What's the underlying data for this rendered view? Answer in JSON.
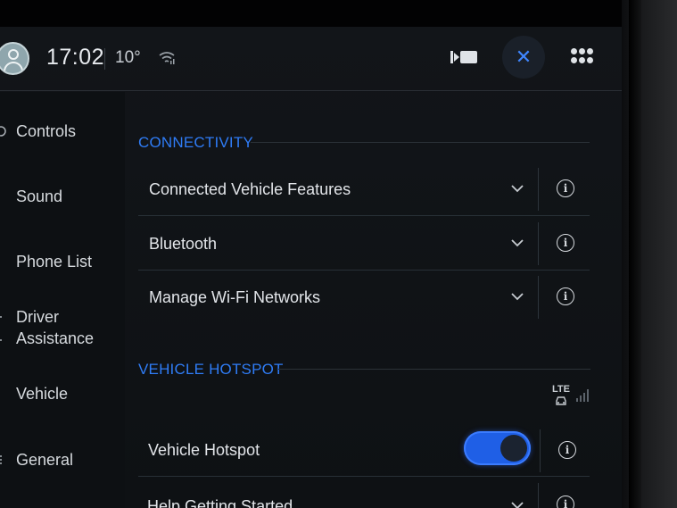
{
  "status_bar": {
    "time": "17:02",
    "temperature": "10°",
    "icons": [
      "user-avatar-icon",
      "wifi-icon",
      "media-icon",
      "close-icon",
      "apps-grid-icon"
    ],
    "close_symbol": "✕"
  },
  "sidebar": {
    "items": [
      {
        "label": "Controls"
      },
      {
        "label": "Sound"
      },
      {
        "label": "Phone List"
      },
      {
        "label": "Driver\nAssistance"
      },
      {
        "label": "Vehicle"
      },
      {
        "label": "General"
      }
    ]
  },
  "main": {
    "sections": [
      {
        "title": "CONNECTIVITY",
        "rows": [
          {
            "label": "Connected Vehicle Features",
            "control": "chevron-down"
          },
          {
            "label": "Bluetooth",
            "control": "chevron-down"
          },
          {
            "label": "Manage Wi-Fi Networks",
            "control": "chevron-down"
          }
        ]
      },
      {
        "title": "VEHICLE HOTSPOT",
        "signal_label": "LTE",
        "rows": [
          {
            "label": "Vehicle Hotspot",
            "control": "toggle",
            "toggle_on": true
          },
          {
            "label": "Help Getting Started",
            "control": "chevron-down"
          }
        ]
      }
    ],
    "info_symbol": "i"
  },
  "colors": {
    "accent": "#2f7cf6",
    "toggle_on": "#1f5fe6",
    "background": "#121519",
    "text": "#e2e5e9"
  }
}
